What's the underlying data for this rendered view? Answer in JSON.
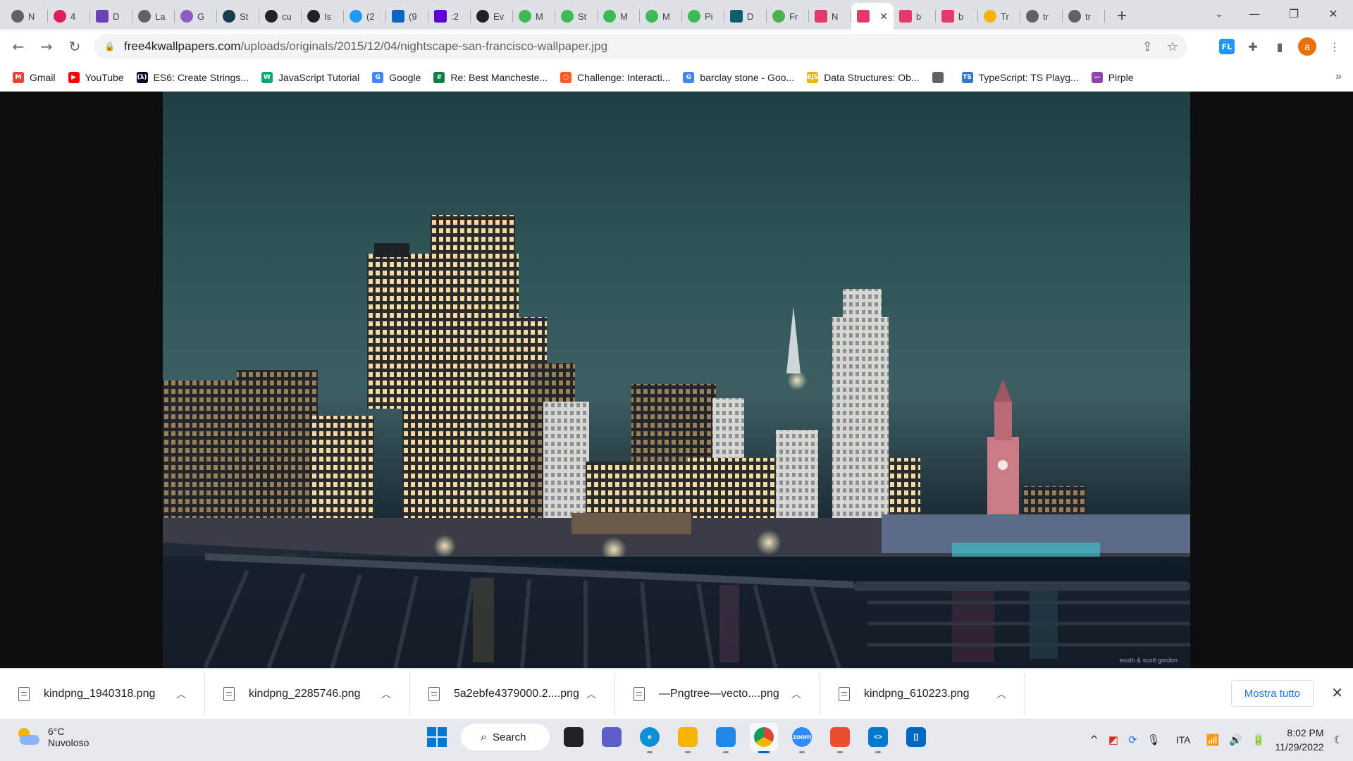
{
  "tabs": [
    {
      "title": "N",
      "icon": "globe-icon",
      "color": "#5f6368"
    },
    {
      "title": "4",
      "icon": "slack-icon",
      "color": "#e01e5a"
    },
    {
      "title": "D",
      "icon": "dev-icon",
      "color": "#6c3fb5"
    },
    {
      "title": "La",
      "icon": "globe-icon",
      "color": "#5f6368"
    },
    {
      "title": "G",
      "icon": "graphql-icon",
      "color": "#8e5bc7"
    },
    {
      "title": "St",
      "icon": "react-icon",
      "color": "#1b3b4b"
    },
    {
      "title": "cu",
      "icon": "github-icon",
      "color": "#202124"
    },
    {
      "title": "Is",
      "icon": "github-icon",
      "color": "#202124"
    },
    {
      "title": "(2",
      "icon": "twitter-icon",
      "color": "#1d9bf0"
    },
    {
      "title": "(9",
      "icon": "linkedin-icon",
      "color": "#0a66c2"
    },
    {
      "title": ":2",
      "icon": "yahoo-icon",
      "color": "#6001d2"
    },
    {
      "title": "Ev",
      "icon": "github-icon",
      "color": "#202124"
    },
    {
      "title": "M",
      "icon": "chat-icon",
      "color": "#3cba54"
    },
    {
      "title": "St",
      "icon": "chat-icon",
      "color": "#3cba54"
    },
    {
      "title": "M",
      "icon": "chat-icon",
      "color": "#3cba54"
    },
    {
      "title": "M",
      "icon": "chat-icon",
      "color": "#3cba54"
    },
    {
      "title": "Pi",
      "icon": "chat-icon",
      "color": "#3cba54"
    },
    {
      "title": "D",
      "icon": "kp-icon",
      "color": "#0e5e6f"
    },
    {
      "title": "Fr",
      "icon": "leaf-icon",
      "color": "#4caf50"
    },
    {
      "title": "N",
      "icon": "image-icon",
      "color": "#e5396c"
    },
    {
      "title": "",
      "icon": "image-icon",
      "color": "#e5396c",
      "active": true
    },
    {
      "title": "b",
      "icon": "image-icon",
      "color": "#e5396c"
    },
    {
      "title": "b",
      "icon": "image-icon",
      "color": "#e5396c"
    },
    {
      "title": "Tr",
      "icon": "trello-icon",
      "color": "#f4b400"
    },
    {
      "title": "tr",
      "icon": "globe-icon",
      "color": "#5f6368"
    },
    {
      "title": "tr",
      "icon": "globe-icon",
      "color": "#5f6368"
    }
  ],
  "address": {
    "host": "free4kwallpapers.com",
    "path": "/uploads/originals/2015/12/04/nightscape-san-francisco-wallpaper.jpg"
  },
  "profile_initial": "a",
  "extension_badge": "FL",
  "bookmarks": [
    {
      "label": "Gmail",
      "icon": "gmail-icon",
      "color": "#ea4335",
      "glyph": "M"
    },
    {
      "label": "YouTube",
      "icon": "youtube-icon",
      "color": "#ff0000",
      "glyph": "▶"
    },
    {
      "label": "ES6: Create Strings...",
      "icon": "freecodecamp-icon",
      "color": "#0a0a23",
      "glyph": "(λ)"
    },
    {
      "label": "JavaScript Tutorial",
      "icon": "w3schools-icon",
      "color": "#04aa6d",
      "glyph": "W"
    },
    {
      "label": "Google",
      "icon": "google-icon",
      "color": "#4285f4",
      "glyph": "G"
    },
    {
      "label": "Re: Best Mancheste...",
      "icon": "forum-icon",
      "color": "#0b8043",
      "glyph": "#"
    },
    {
      "label": "Challenge: Interacti...",
      "icon": "challenge-icon",
      "color": "#ff5722",
      "glyph": "○"
    },
    {
      "label": "barclay stone - Goo...",
      "icon": "google-icon",
      "color": "#4285f4",
      "glyph": "G"
    },
    {
      "label": "Data Structures: Ob...",
      "icon": "ejs-icon",
      "color": "#e6b800",
      "glyph": "EJS"
    },
    {
      "label": "",
      "icon": "globe-icon",
      "color": "#5f6368",
      "glyph": ""
    },
    {
      "label": "TypeScript: TS Playg...",
      "icon": "typescript-icon",
      "color": "#3178c6",
      "glyph": "TS"
    },
    {
      "label": "Pirple",
      "icon": "pirple-icon",
      "color": "#8e44ad",
      "glyph": "—"
    }
  ],
  "downloads": [
    {
      "name": "kindpng_1940318.png"
    },
    {
      "name": "kindpng_2285746.png"
    },
    {
      "name": "5a2ebfe4379000.2....png"
    },
    {
      "name": "—Pngtree—vecto....png"
    },
    {
      "name": "kindpng_610223.png"
    }
  ],
  "downloads_show_all": "Mostra tutto",
  "wallpaper_watermark": "south & scott gordon",
  "taskbar": {
    "weather": {
      "temp": "6°C",
      "condition": "Nuvoloso"
    },
    "search_label": "Search",
    "apps": [
      {
        "name": "task-view",
        "color": "#202124",
        "glyph": ""
      },
      {
        "name": "teams",
        "color": "#5b5fc7",
        "glyph": ""
      },
      {
        "name": "edge",
        "color": "#0c8fd6",
        "glyph": "e"
      },
      {
        "name": "file-explorer",
        "color": "#f4b400",
        "glyph": ""
      },
      {
        "name": "photos",
        "color": "#1e88e5",
        "glyph": ""
      },
      {
        "name": "chrome",
        "color": "#db4437",
        "glyph": "",
        "active": true
      },
      {
        "name": "zoom",
        "color": "#2d8cff",
        "glyph": "zoom"
      },
      {
        "name": "git",
        "color": "#e94e31",
        "glyph": ""
      },
      {
        "name": "vscode",
        "color": "#007acc",
        "glyph": "<>"
      },
      {
        "name": "replit",
        "color": "#0067c0",
        "glyph": "[]"
      }
    ],
    "language": "ITA",
    "time": "8:02 PM",
    "date": "11/29/2022"
  }
}
